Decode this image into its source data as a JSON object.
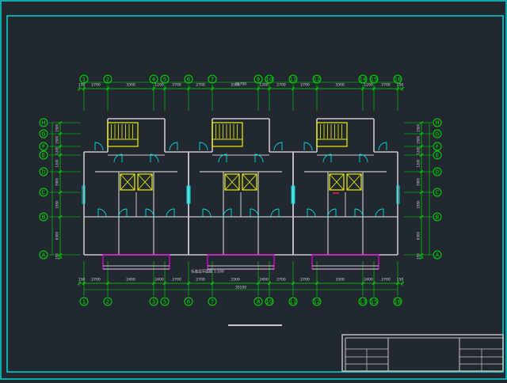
{
  "drawing": {
    "colors": {
      "background": "#212830",
      "frame": "#00d8d8",
      "wall": "#c8c8c8",
      "axis": "#00e000",
      "dimension": "#00e000",
      "dimension_text": "#d8d8d8",
      "stair": "#f0f000",
      "door": "#00e0e0",
      "balcony": "#e000e0",
      "note": "#e03030"
    },
    "axes_top": [
      "1",
      "2",
      "4",
      "5",
      "6",
      "7",
      "9",
      "10",
      "11",
      "12",
      "14",
      "15",
      "16"
    ],
    "axes_bottom": [
      "1",
      "2",
      "3",
      "5",
      "6",
      "7",
      "8",
      "10",
      "11",
      "12",
      "13",
      "15",
      "16"
    ],
    "axes_side": [
      "H",
      "G",
      "F",
      "E",
      "D",
      "C",
      "B",
      "A"
    ],
    "total_dimension_top": "35700",
    "total_dimension_bottom": "35100",
    "dims_top": [
      "150",
      "2700",
      "3300",
      "1200",
      "2700",
      "2700",
      "3300",
      "1200",
      "2700",
      "2700",
      "3300",
      "1200",
      "2700",
      "150"
    ],
    "dims_bottom": [
      "150",
      "2700",
      "2400",
      "2400",
      "2700",
      "2700",
      "3300",
      "2400",
      "2700",
      "2700",
      "3300",
      "2400",
      "2700",
      "150"
    ],
    "dims_side_outer": [
      "1500",
      "1500",
      "1200",
      "1200",
      "3900",
      "1950",
      "6300",
      "150"
    ],
    "plan_caption": "标准层平面图 1:100",
    "title_block": {
      "cells": [
        "",
        "",
        "",
        "",
        "",
        "",
        "",
        "",
        "",
        ""
      ]
    }
  }
}
